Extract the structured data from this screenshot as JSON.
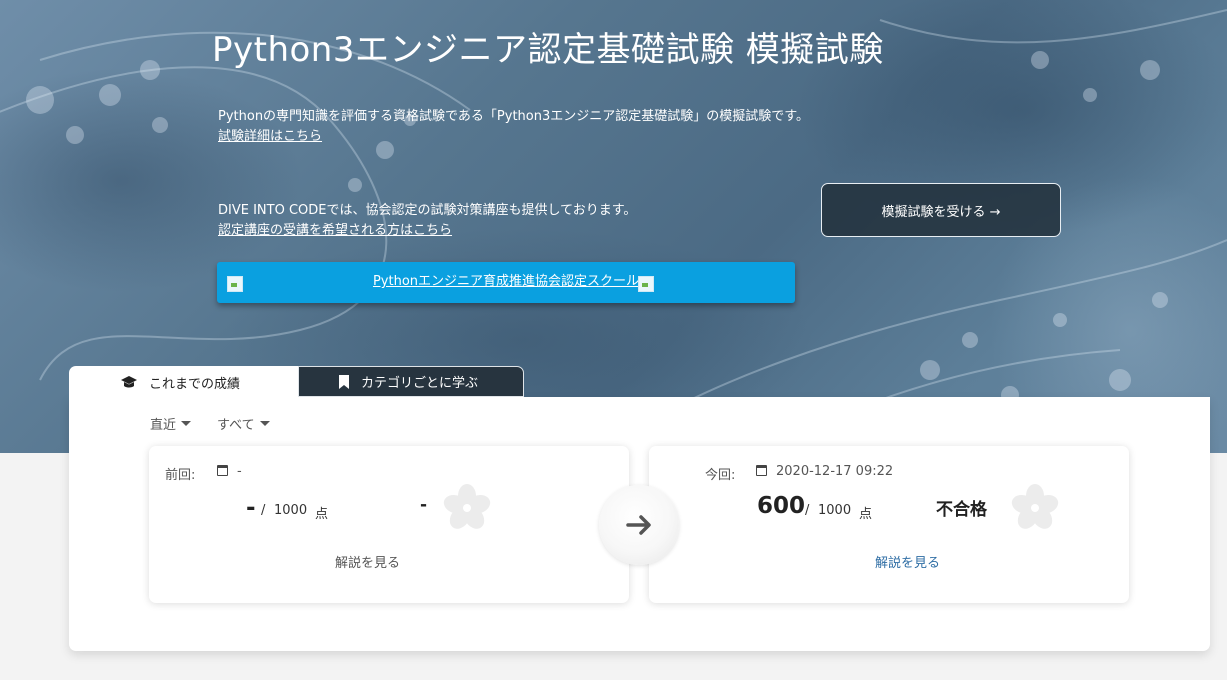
{
  "hero": {
    "title": "Python3エンジニア認定基礎試験  模擬試験",
    "description": "Pythonの専門知識を評価する資格試験である「Python3エンジニア認定基礎試験」の模擬試験です。",
    "detail_link": "試験詳細はこちら",
    "dic_text": "DIVE INTO CODEでは、協会認定の試験対策講座も提供しております。",
    "course_link": "認定講座の受講を希望される方はこちら",
    "banner_text": "Pythonエンジニア育成推進協会認定スクール",
    "cta_label": "模擬試験を受ける →"
  },
  "tabs": [
    {
      "label": "これまでの成績",
      "icon": "graduation-cap-icon",
      "active": true
    },
    {
      "label": "カテゴリごとに学ぶ",
      "icon": "bookmark-icon",
      "active": false
    }
  ],
  "filters": {
    "period": "直近",
    "category": "すべて"
  },
  "previous": {
    "label": "前回:",
    "date": "-",
    "score": "-",
    "separator": "/",
    "max": "1000",
    "unit": "点",
    "result": "-",
    "explain_link": "解説を見る"
  },
  "current": {
    "label": "今回:",
    "date": "2020-12-17 09:22",
    "score": "600",
    "separator": "/",
    "max": "1000",
    "unit": "点",
    "result": "不合格",
    "explain_link": "解説を見る"
  },
  "colors": {
    "banner": "#0aa0e0",
    "cta_bg": "#23323e",
    "link_blue": "#2e6da4",
    "tab_dark": "#27343f"
  }
}
